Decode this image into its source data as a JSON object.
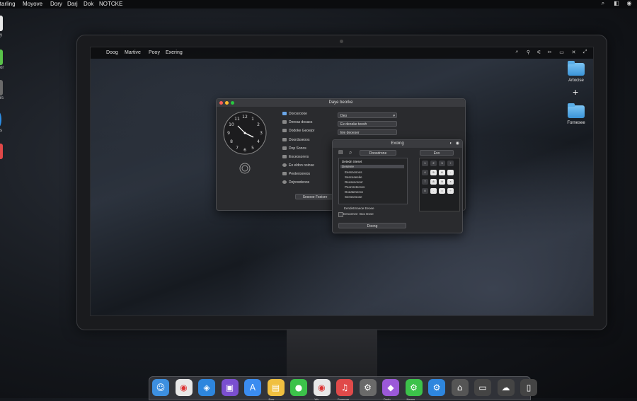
{
  "outer_menubar": {
    "items": [
      "itarling",
      "Moyove",
      "Dory",
      "Darj",
      "Dok",
      "NOTCKE"
    ]
  },
  "left_icons": [
    {
      "label": "y",
      "color": "#e8e8e8"
    },
    {
      "label": "or",
      "color": "#59c24a"
    },
    {
      "label": "rs",
      "color": "#6a6a6a"
    },
    {
      "label": "s",
      "color": "#2c8ee6"
    },
    {
      "label": "",
      "color": "#e04848"
    }
  ],
  "inner_menubar": {
    "items": [
      "Doog",
      "Martive",
      "Pooy",
      "Exering"
    ]
  },
  "desktop": {
    "icons": [
      {
        "label": "Artocise",
        "icon": "folder-icon"
      },
      {
        "label": "Fornesee",
        "icon": "folder-icon"
      }
    ],
    "plus_label": "+"
  },
  "window_main": {
    "title": "Daye beorke",
    "sidebar": [
      "Dorosrooke",
      "Dereas dosacs",
      "Dodoke Geoejor",
      "Doordsseoos",
      "Dop Sonos",
      "Eoceosorers",
      "Eo eldon ooinse",
      "Peoterooreos",
      "Dejrowdeoos"
    ],
    "fields": [
      "Deo",
      "Ex deoeke teosh",
      "Eie deoeser"
    ],
    "bottom_button": "Sesooe Fseisre"
  },
  "window_second": {
    "title": "Exoing",
    "search_button": "Doosdrone",
    "top_right_button": "Exo",
    "list_header": "Detedn Sieset",
    "list_selected": "Deseree",
    "list_items": [
      "Eessnosoos",
      "Sesceseeke",
      "Deosesoreor",
      "Peorsreterons",
      "Doeateneron",
      "Senssnsose"
    ],
    "status": "Eendetrnaeoe Eeoee",
    "checkbox_label": "Desoenee",
    "checkbox_label2": "Boo Dose",
    "bottom_button": "Doong",
    "calc_keys": [
      "1",
      "2",
      "3",
      "+",
      "4",
      "5",
      "6",
      "-",
      "7",
      "8",
      "9",
      "×",
      "0",
      ".",
      "=",
      "÷"
    ]
  },
  "dock": {
    "apps": [
      {
        "name": "finder-icon",
        "color": "#3d8fe0",
        "label": ""
      },
      {
        "name": "chrome-icon",
        "color": "#e8e8e8",
        "label": ""
      },
      {
        "name": "safari-icon",
        "color": "#2e86de",
        "label": ""
      },
      {
        "name": "wallet-icon",
        "color": "#7a4fd0",
        "label": ""
      },
      {
        "name": "appstore-icon",
        "color": "#3b8cf0",
        "label": ""
      },
      {
        "name": "files-icon",
        "color": "#f0c040",
        "label": "Eow"
      },
      {
        "name": "messages-icon",
        "color": "#3cc24a",
        "label": ""
      },
      {
        "name": "chrome2-icon",
        "color": "#e8e8e8",
        "label": "Ws"
      },
      {
        "name": "music-icon",
        "color": "#e04a4a",
        "label": "Fromrom"
      },
      {
        "name": "settings-icon",
        "color": "#6a6a6a",
        "label": ""
      },
      {
        "name": "podcast-icon",
        "color": "#9b59d8",
        "label": "Dodo"
      },
      {
        "name": "gear-green-icon",
        "color": "#3cc24a",
        "label": "Neaos"
      },
      {
        "name": "gear-blue-icon",
        "color": "#2e86de",
        "label": ""
      },
      {
        "name": "home-icon",
        "color": "#555",
        "label": ""
      },
      {
        "name": "gamepad-icon",
        "color": "#444",
        "label": ""
      },
      {
        "name": "cloud-icon",
        "color": "#444",
        "label": ""
      },
      {
        "name": "trash-icon",
        "color": "#444",
        "label": ""
      }
    ]
  }
}
